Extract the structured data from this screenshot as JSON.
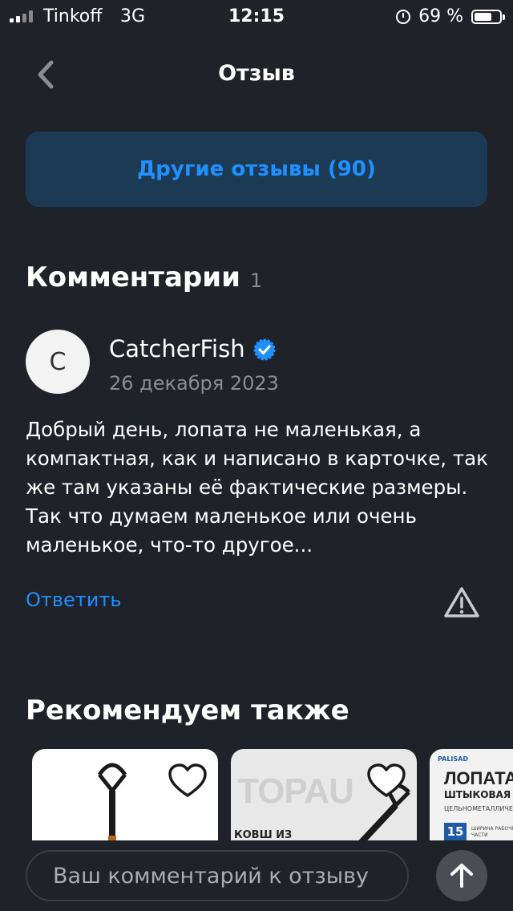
{
  "status_bar": {
    "carrier": "Tinkoff",
    "network": "3G",
    "time": "12:15",
    "battery": "69 %",
    "battery_level": 0.69,
    "icons": [
      "signal-icon",
      "alarm-icon",
      "battery-icon"
    ]
  },
  "nav": {
    "back_icon": "chevron-left-icon",
    "title": "Отзыв"
  },
  "other_reviews_label": "Другие отзывы (90)",
  "comments": {
    "heading": "Комментарии",
    "count": "1",
    "items": [
      {
        "avatar_letter": "C",
        "author": "CatcherFish",
        "verified_icon": "verified-check-icon",
        "date": "26 декабря 2023",
        "text": "Добрый день, лопата не маленькая, а компактная, как и написано в карточке, так же там указаны её фактические размеры. Так что думаем маленькое или очень маленькое, что-то другое...",
        "reply_label": "Ответить",
        "report_icon": "warning-icon"
      }
    ]
  },
  "recommend": {
    "heading": "Рекомендуем также",
    "products": [
      {
        "image": "shovel-product-image",
        "favorite_icon": "heart-icon"
      },
      {
        "image_text": "TOPAU",
        "caption": "КОВШ ИЗ",
        "favorite_icon": "heart-icon"
      },
      {
        "brand": "PALISAD",
        "title": "ЛОПАТА",
        "subtitle": "ШТЫКОВАЯ",
        "subtitle2": "ЦЕЛЬНОМЕТАЛЛИЧЕ",
        "badge": "15",
        "note": "ШИРИНА РАБОЧЕЙ ЧАСТИ"
      }
    ]
  },
  "comment_input": {
    "placeholder": "Ваш комментарий к отзыву",
    "send_icon": "arrow-up-icon"
  },
  "colors": {
    "background": "#1f2228",
    "accent": "#1e90ff",
    "button_bg": "#1d3a55",
    "muted_text": "#8a8d93"
  }
}
